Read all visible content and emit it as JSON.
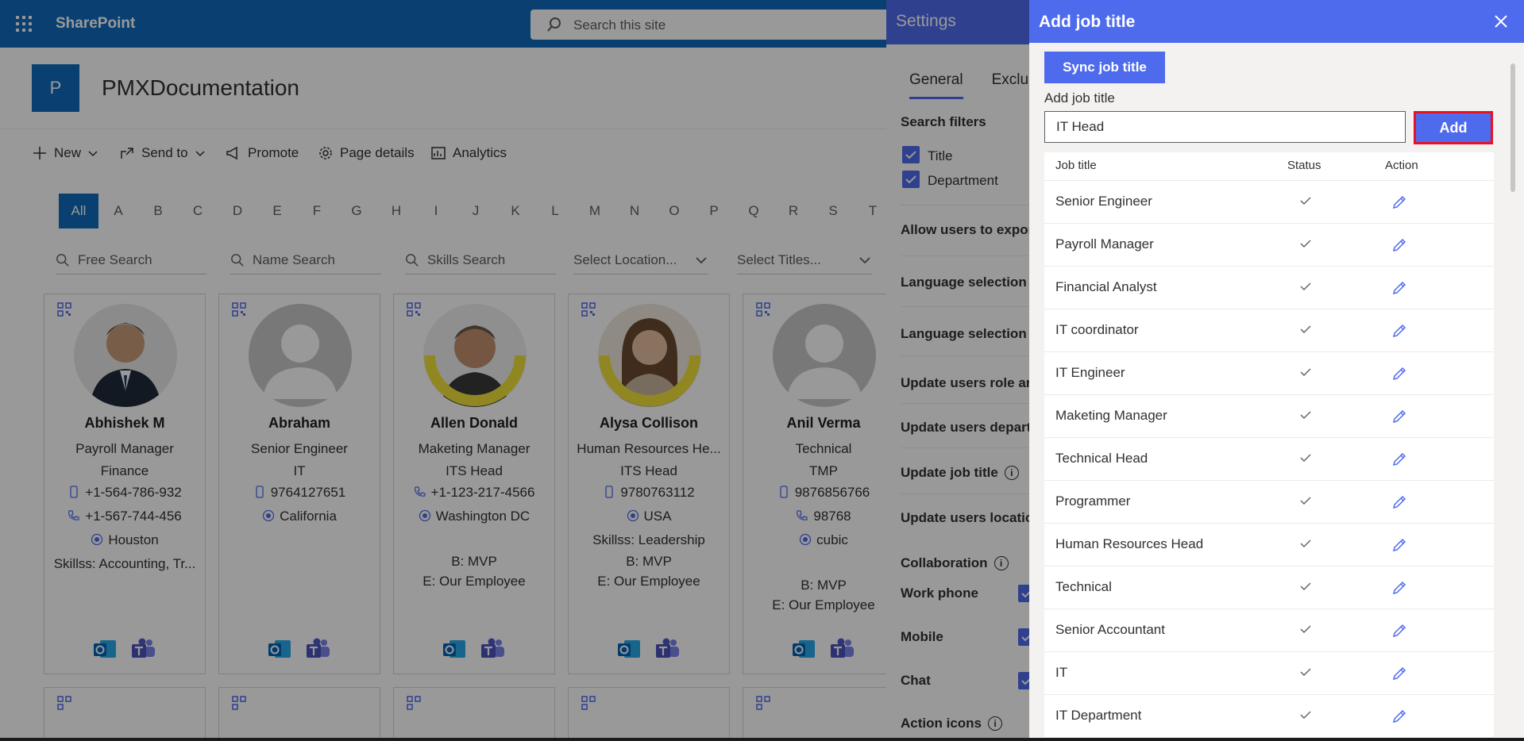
{
  "suitebar": {
    "brand": "SharePoint",
    "search_placeholder": "Search this site"
  },
  "site": {
    "logo_letter": "P",
    "title": "PMXDocumentation"
  },
  "commands": [
    {
      "label": "New",
      "icon": "plus-icon"
    },
    {
      "label": "Send to",
      "icon": "share-icon"
    },
    {
      "label": "Promote",
      "icon": "megaphone-icon"
    },
    {
      "label": "Page details",
      "icon": "gear-icon"
    },
    {
      "label": "Analytics",
      "icon": "chart-icon"
    }
  ],
  "alphabet": [
    "All",
    "A",
    "B",
    "C",
    "D",
    "E",
    "F",
    "G",
    "H",
    "I",
    "J",
    "K",
    "L",
    "M",
    "N",
    "O",
    "P",
    "Q",
    "R",
    "S",
    "T"
  ],
  "filters": {
    "free_search": "Free Search",
    "name_search": "Name Search",
    "skills_search": "Skills Search",
    "location_select": "Select Location...",
    "titles_select": "Select Titles..."
  },
  "cards": [
    {
      "name": "Abhishek M",
      "title": "Payroll Manager",
      "dept": "Finance",
      "mobile": "+1-564-786-932",
      "phone": "+1-567-744-456",
      "location": "Houston",
      "skills": "Skillss: Accounting, Tr...",
      "b": "",
      "e": ""
    },
    {
      "name": "Abraham",
      "title": "Senior Engineer",
      "dept": "IT",
      "mobile": "9764127651",
      "phone": "",
      "location": "California",
      "skills": "",
      "b": "",
      "e": ""
    },
    {
      "name": "Allen Donald",
      "title": "Maketing Manager",
      "dept": "ITS Head",
      "mobile": "",
      "phone": "+1-123-217-4566",
      "location": "Washington DC",
      "skills": "",
      "b": "B: MVP",
      "e": "E: Our Employee"
    },
    {
      "name": "Alysa Collison",
      "title": "Human Resources He...",
      "dept": "ITS Head",
      "mobile": "9780763112",
      "phone": "",
      "location": "USA",
      "skills": "Skillss: Leadership",
      "b": "B: MVP",
      "e": "E: Our Employee"
    },
    {
      "name": "Anil Verma",
      "title": "Technical",
      "dept": "TMP",
      "mobile": "9876856766",
      "phone": "98768",
      "location": "cubic",
      "skills": "",
      "b": "B: MVP",
      "e": "E: Our Employee"
    }
  ],
  "settings": {
    "title": "Settings",
    "tabs": [
      "General",
      "Exclu"
    ],
    "search_filters": "Search filters",
    "filter_title": "Title",
    "filter_department": "Department",
    "allow_export": "Allow users to expor",
    "language_selection_a": "Language selection a",
    "language_selection": "Language selection",
    "update_role": "Update users role ar",
    "update_depart": "Update users depart",
    "update_job_title": "Update job title",
    "update_location": "Update users locatio",
    "collaboration": "Collaboration",
    "work_phone": "Work phone",
    "mobile": "Mobile",
    "chat": "Chat",
    "action_icons": "Action icons"
  },
  "add_job_title": {
    "title": "Add job title",
    "sync_label": "Sync job title",
    "field_label": "Add job title",
    "input_value": "IT Head",
    "add_label": "Add",
    "columns": {
      "job_title": "Job title",
      "status": "Status",
      "action": "Action"
    },
    "rows": [
      "Senior Engineer",
      "Payroll Manager",
      "Financial Analyst",
      "IT coordinator",
      "IT Engineer",
      "Maketing Manager",
      "Technical Head",
      "Programmer",
      "Human Resources Head",
      "Technical",
      "Senior Accountant",
      "IT",
      "IT Department"
    ]
  },
  "colors": {
    "suitebar": "#0f6cbd",
    "panel_accent": "#4f6bed",
    "add_border": "#e81123"
  }
}
